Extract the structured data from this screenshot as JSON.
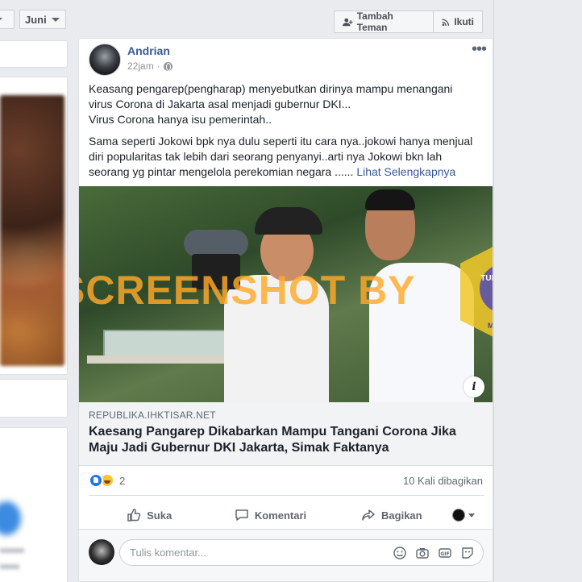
{
  "filters": {
    "month_label": "Juni"
  },
  "profile_header": {
    "add_friend_label": "Tambah Teman",
    "follow_label": "Ikuti"
  },
  "post": {
    "author": "Andrian",
    "time": "22jam",
    "paragraph1": "Keasang pengarep(pengharap) menyebutkan dirinya mampu menangani virus Corona di Jakarta asal menjadi gubernur DKI...\nVirus Corona hanya isu pemerintah..",
    "paragraph2": "Sama seperti Jokowi bpk nya dulu seperti itu cara nya..jokowi hanya menjual diri popularitas tak lebih dari seorang penyanyi..arti nya Jokowi bkn lah seorang yg pintar mengelola perekomian negara ......",
    "see_more": "Lihat Selengkapnya"
  },
  "image": {
    "watermark": "SCREENSHOT BY",
    "badge_top": "TURN BACK HOAX",
    "badge_bottom": "MAFINDO",
    "info_icon": "i"
  },
  "link_preview": {
    "domain": "REPUBLIKA.IHKTISAR.NET",
    "title": "Kaesang Pangarep Dikabarkan Mampu Tangani Corona Jika Maju Jadi Gubernur DKI Jakarta, Simak Faktanya"
  },
  "engagement": {
    "reaction_count": "2",
    "shares": "10 Kali dibagikan"
  },
  "actions": {
    "like": "Suka",
    "comment": "Komentari",
    "share": "Bagikan"
  },
  "comment_box": {
    "placeholder": "Tulis komentar..."
  },
  "colors": {
    "link": "#385898",
    "accent": "#1877f2",
    "background": "#e9ebee"
  }
}
